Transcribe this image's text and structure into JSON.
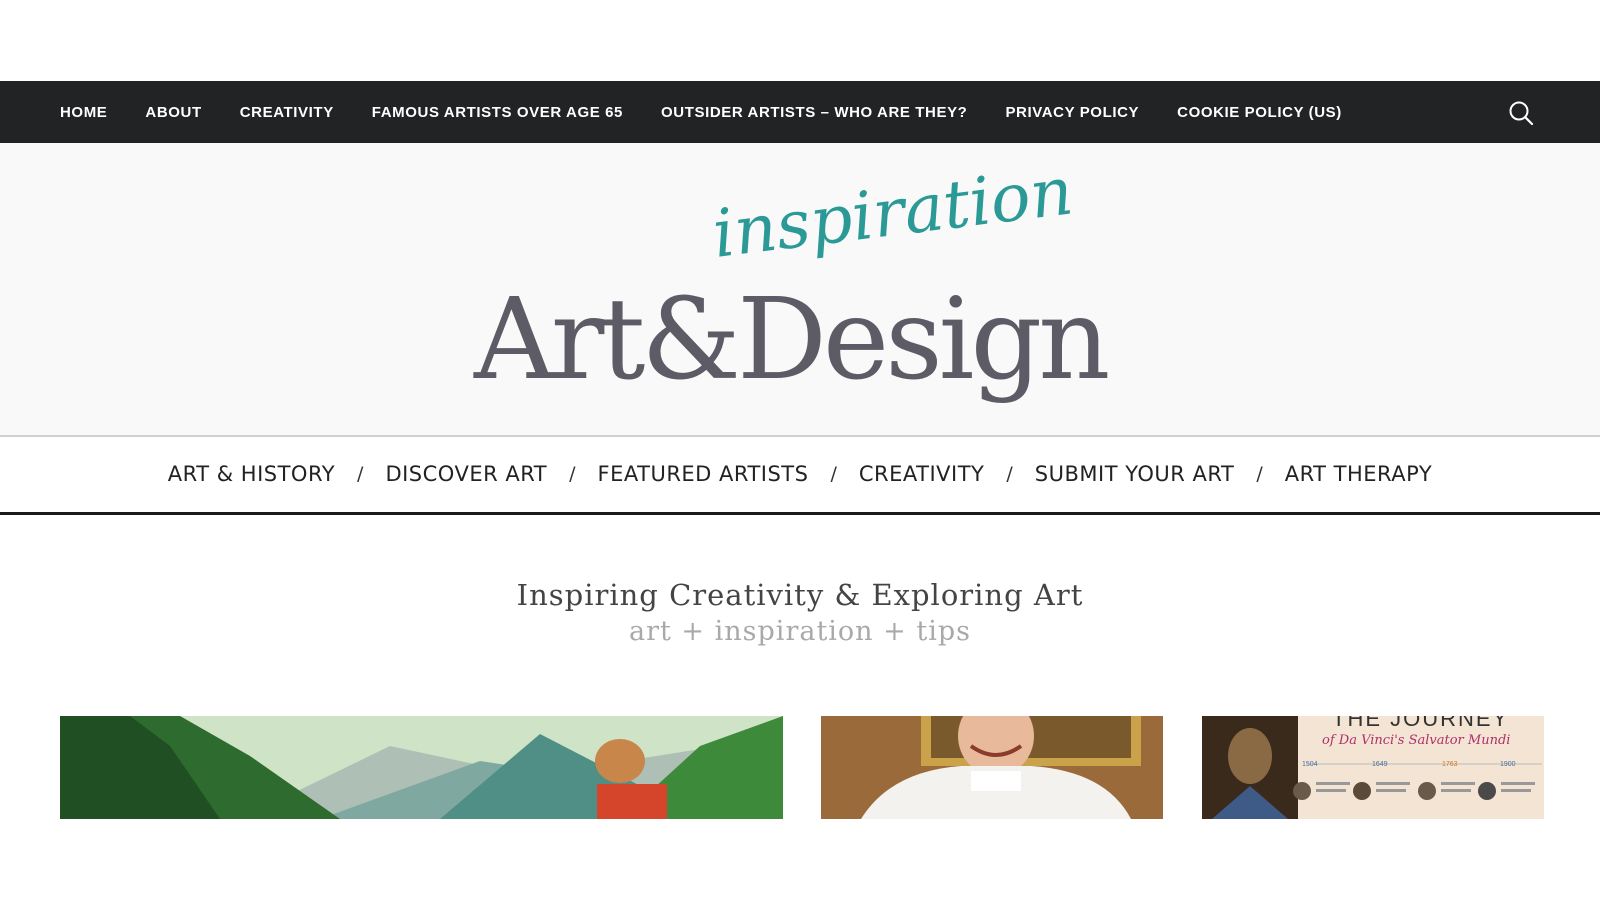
{
  "top_nav": {
    "items": [
      {
        "label": "HOME"
      },
      {
        "label": "ABOUT"
      },
      {
        "label": "CREATIVITY"
      },
      {
        "label": "FAMOUS ARTISTS OVER AGE 65"
      },
      {
        "label": "OUTSIDER ARTISTS – WHO ARE THEY?"
      },
      {
        "label": "PRIVACY POLICY"
      },
      {
        "label": "COOKIE POLICY (US)"
      }
    ],
    "search_icon": "search-icon"
  },
  "logo": {
    "script_text": "inspiration",
    "main_text": "Art&Design",
    "colors": {
      "script": "#2b9a97",
      "main": "#5d5c66"
    }
  },
  "category_nav": {
    "items": [
      {
        "label": "ART & HISTORY"
      },
      {
        "label": "DISCOVER ART"
      },
      {
        "label": "FEATURED ARTISTS"
      },
      {
        "label": "CREATIVITY"
      },
      {
        "label": "SUBMIT YOUR ART"
      },
      {
        "label": "ART THERAPY"
      }
    ],
    "separator": "/"
  },
  "tagline": {
    "title": "Inspiring Creativity & Exploring Art",
    "subtitle": "art + inspiration + tips"
  },
  "featured": {
    "infographic_title": "THE JOURNEY",
    "infographic_subtitle": "of Da Vinci's Salvator Mundi",
    "years": [
      "1504",
      "1649",
      "1763",
      "1900"
    ]
  }
}
